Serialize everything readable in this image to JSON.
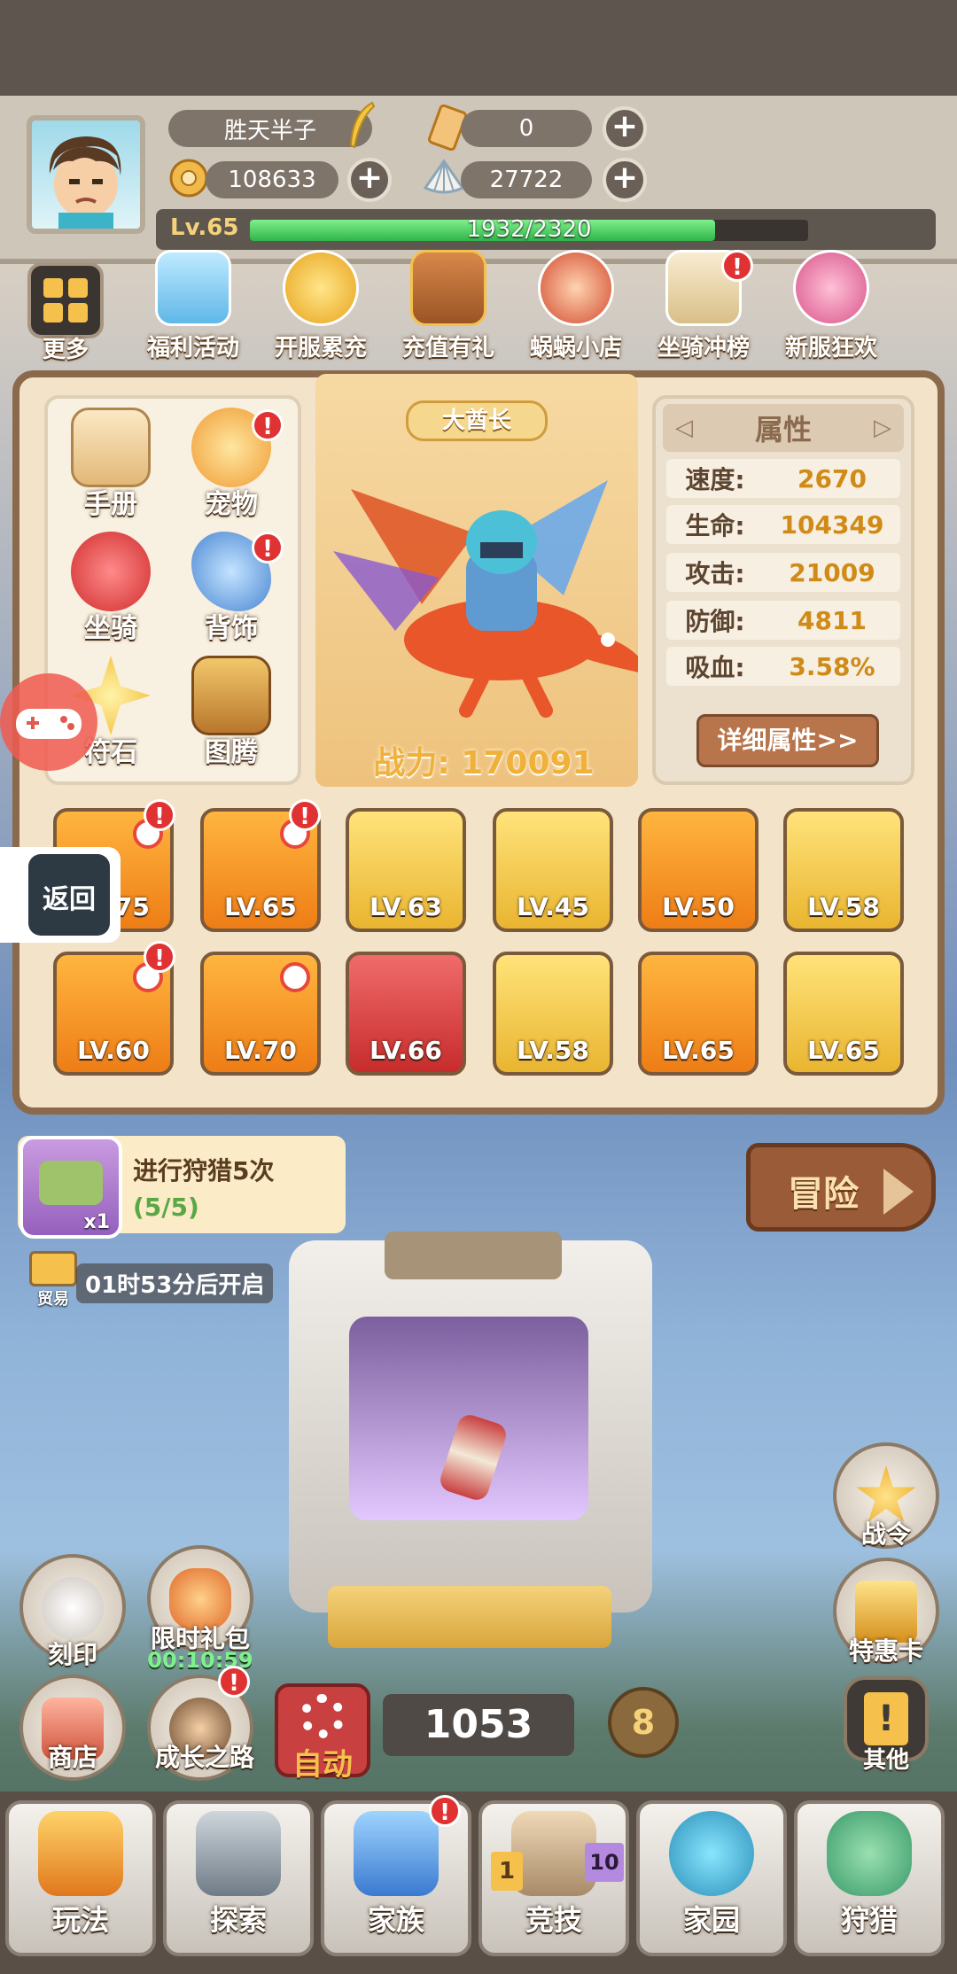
{
  "player": {
    "name": "胜天半子",
    "tickets": "0",
    "coins": "108633",
    "shells": "27722",
    "level": "Lv.65",
    "exp": "1932/2320",
    "exp_fraction": 0.833
  },
  "top_nav": {
    "more_label": "更多",
    "items": [
      {
        "label": "福利活动",
        "icon": "gift-crystal-icon"
      },
      {
        "label": "开服累充",
        "icon": "gold-medal-icon"
      },
      {
        "label": "充值有礼",
        "icon": "treasure-chest-icon"
      },
      {
        "label": "蜗蜗小店",
        "icon": "shop-girl-icon"
      },
      {
        "label": "坐骑冲榜",
        "icon": "podium-icon"
      },
      {
        "label": "新服狂欢",
        "icon": "party-icon"
      }
    ]
  },
  "features": [
    {
      "label": "手册"
    },
    {
      "label": "宠物"
    },
    {
      "label": "坐骑"
    },
    {
      "label": "背饰"
    },
    {
      "label": "符石"
    },
    {
      "label": "图腾"
    }
  ],
  "hero": {
    "title": "大酋长",
    "power": "战力: 170091"
  },
  "attributes": {
    "title": "属性",
    "rows": [
      {
        "k": "速度:",
        "v": "2670"
      },
      {
        "k": "生命:",
        "v": "104349"
      },
      {
        "k": "攻击:",
        "v": "21009"
      },
      {
        "k": "防御:",
        "v": "4811"
      },
      {
        "k": "吸血:",
        "v": "3.58%"
      }
    ],
    "detail_button": "详细属性>>"
  },
  "equipment": [
    {
      "lv": "LV.75"
    },
    {
      "lv": "LV.65"
    },
    {
      "lv": "LV.63"
    },
    {
      "lv": "LV.45"
    },
    {
      "lv": "LV.50"
    },
    {
      "lv": "LV.58"
    },
    {
      "lv": "LV.60"
    },
    {
      "lv": "LV.70"
    },
    {
      "lv": "LV.66"
    },
    {
      "lv": "LV.58"
    },
    {
      "lv": "LV.65"
    },
    {
      "lv": "LV.65"
    }
  ],
  "quest": {
    "title": "进行狩猎5次",
    "progress": "(5/5)",
    "reward_count": "x1"
  },
  "trade": {
    "label": "贸易",
    "timer": "01时53分后开启"
  },
  "back_label": "返回",
  "adventure_label": "冒险",
  "left_buttons": [
    {
      "label": "刻印"
    },
    {
      "label": "限时礼包",
      "timer": "00:10:59"
    },
    {
      "label": "商店"
    },
    {
      "label": "成长之路"
    }
  ],
  "right_buttons": [
    {
      "label": "战令"
    },
    {
      "label": "特惠卡"
    },
    {
      "label": "其他"
    }
  ],
  "auto_label": "自动",
  "resource_count": "1053",
  "speed_count": "8",
  "bottom_tabs": [
    {
      "label": "玩法"
    },
    {
      "label": "探索"
    },
    {
      "label": "家族"
    },
    {
      "label": "竞技",
      "left_num": "1",
      "right_num": "10"
    },
    {
      "label": "家园"
    },
    {
      "label": "狩猎"
    }
  ],
  "colors": {
    "accent": "#d08a17",
    "badge": "#e03232",
    "exp_bar": "#2fb449",
    "panel_border": "#8b6a4b"
  }
}
